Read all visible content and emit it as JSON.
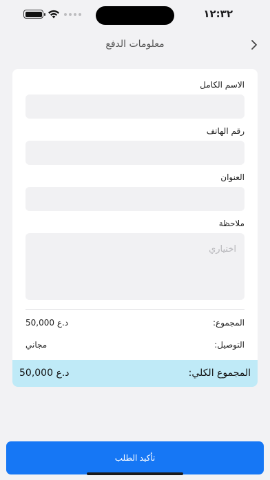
{
  "status_bar": {
    "time": "١٢:٣٢"
  },
  "header": {
    "title": "معلومات الدفع",
    "back_icon": "chevron-right-icon"
  },
  "form": {
    "full_name": {
      "label": "الاسم الكامل",
      "value": ""
    },
    "phone": {
      "label": "رقم الهاتف",
      "value": ""
    },
    "address": {
      "label": "العنوان",
      "value": ""
    },
    "note": {
      "label": "ملاحظة",
      "placeholder": "اختياري",
      "value": ""
    }
  },
  "summary": {
    "subtotal_label": "المجموع:",
    "subtotal_value": "50,000 د.ع",
    "delivery_label": "التوصيل:",
    "delivery_value": "مجاني",
    "total_label": "المجموع الكلي:",
    "total_value": "50,000 د.ع"
  },
  "actions": {
    "confirm_label": "تأكيد الطلب"
  },
  "colors": {
    "accent": "#1677f5",
    "total_highlight": "#bfeaf7",
    "background": "#f2f2f4"
  }
}
